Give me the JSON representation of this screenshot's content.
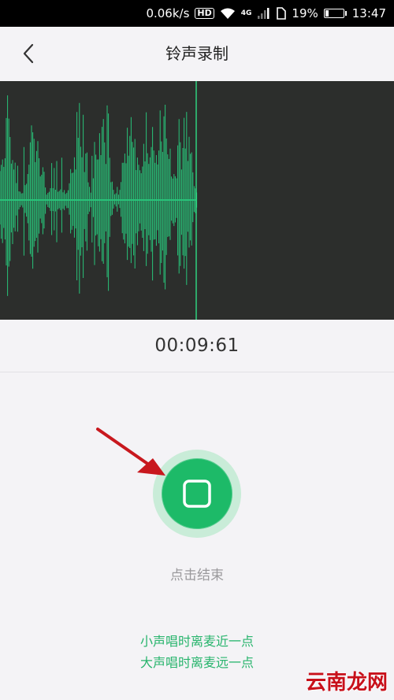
{
  "status_bar": {
    "speed": "0.06k/s",
    "hd": "HD",
    "network": "4G",
    "battery": "19%",
    "battery_level": 0.19,
    "time": "13:47"
  },
  "header": {
    "title": "铃声录制"
  },
  "recorder": {
    "elapsed": "00:09:61",
    "stop_hint": "点击结束",
    "tips": [
      "小声唱时离麦近一点",
      "大声唱时离麦远一点"
    ],
    "accent_color": "#1dba68",
    "waveform_color": "#28c279",
    "waveform_bg": "#2c2e2c"
  },
  "watermark": "云南龙网",
  "annotation_color": "#c8181e"
}
